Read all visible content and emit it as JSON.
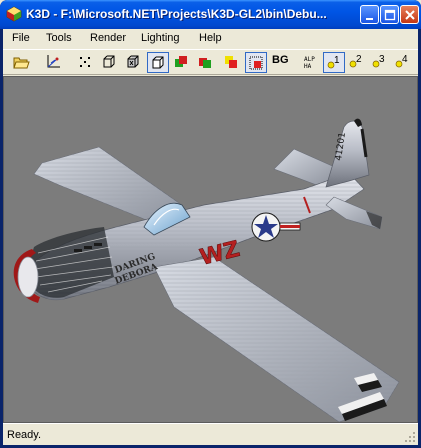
{
  "window": {
    "title": "K3D - F:\\Microsoft.NET\\Projects\\K3D-GL2\\bin\\Debu...",
    "minimize_label": "minimize",
    "maximize_label": "maximize",
    "close_label": "close"
  },
  "menu": {
    "items": [
      {
        "label": "File"
      },
      {
        "label": "Tools"
      },
      {
        "label": "Render"
      },
      {
        "label": "Lighting"
      },
      {
        "label": "Help"
      }
    ]
  },
  "toolbar": {
    "items": [
      {
        "icon": "open-folder-icon"
      },
      {
        "icon": "axes-icon"
      },
      {
        "icon": "points-icon"
      },
      {
        "icon": "wireframe-cube-icon"
      },
      {
        "icon": "hidden-line-cube-icon"
      },
      {
        "icon": "flat-shade-icon",
        "checked": true
      },
      {
        "icon": "smooth-shade-icon"
      },
      {
        "icon": "texture-shade-icon"
      },
      {
        "icon": "material-color-icon"
      },
      {
        "icon": "ambient-color-icon",
        "checked": true
      },
      {
        "icon": "alpha-icon"
      },
      {
        "icon": "light-1-icon",
        "checked": true
      },
      {
        "icon": "light-2-icon"
      },
      {
        "icon": "light-3-icon"
      },
      {
        "icon": "light-4-icon"
      }
    ],
    "bg_label": "BG",
    "lights": [
      "1",
      "2",
      "3",
      "4"
    ]
  },
  "viewport": {
    "background": "#7c7c7c",
    "model": {
      "tail_number": "41201",
      "fuselage_code": "WZ",
      "nose_art_line1": "DARING",
      "nose_art_line2": "DEBORA",
      "star_insignia": "usaaf-star-and-bar"
    }
  },
  "status": {
    "text": "Ready."
  },
  "colors": {
    "title_bar": "#0055e5",
    "face": "#ece9d8",
    "viewport": "#7c7c7c",
    "nose_band": "#a01818",
    "code_letters": "#b42020"
  }
}
